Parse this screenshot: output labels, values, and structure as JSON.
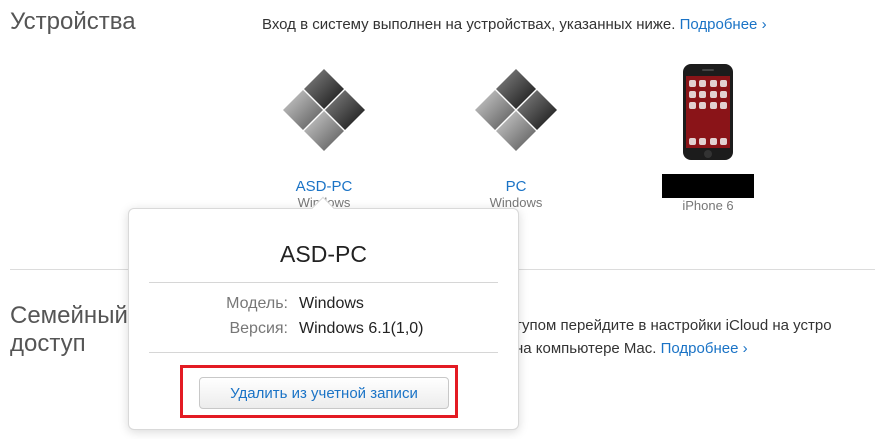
{
  "devices_section": {
    "title": "Устройства",
    "description": "Вход в систему выполнен на устройствах, указанных ниже.",
    "more_link": "Подробнее ›"
  },
  "devices": [
    {
      "name": "ASD-PC",
      "os": "Windows",
      "icon": "windows-icon"
    },
    {
      "name": "PC",
      "os": "Windows",
      "icon": "windows-icon"
    },
    {
      "name": "",
      "os": "iPhone 6",
      "icon": "iphone-icon"
    }
  ],
  "family_section": {
    "title": "Семейный доступ",
    "line1": "тупом перейдите в настройки iCloud на устро",
    "line2_prefix": "на компьютере Mac.",
    "more_link": "Подробнее ›"
  },
  "popover": {
    "title": "ASD-PC",
    "model_label": "Модель:",
    "model_value": "Windows",
    "version_label": "Версия:",
    "version_value": "Windows 6.1(1,0)",
    "remove_button": "Удалить из учетной записи"
  },
  "colors": {
    "link": "#1a73c6",
    "highlight": "#e31b23"
  }
}
